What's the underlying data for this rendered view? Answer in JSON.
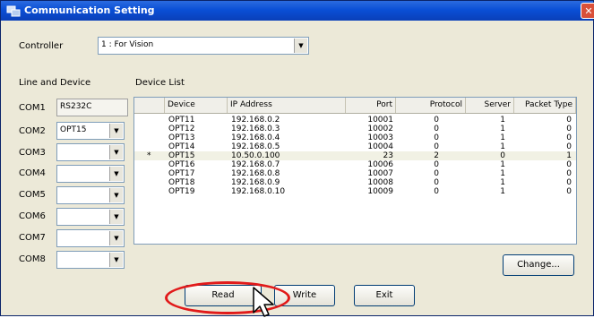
{
  "window": {
    "title": "Communication Setting",
    "close_glyph": "✕"
  },
  "controller": {
    "label": "Controller",
    "value": "1 : For Vision"
  },
  "line_device": {
    "label": "Line and Device",
    "com1": {
      "label": "COM1",
      "value": "RS232C"
    },
    "ports": [
      {
        "label": "COM2",
        "value": "OPT15"
      },
      {
        "label": "COM3",
        "value": ""
      },
      {
        "label": "COM4",
        "value": ""
      },
      {
        "label": "COM5",
        "value": ""
      },
      {
        "label": "COM6",
        "value": ""
      },
      {
        "label": "COM7",
        "value": ""
      },
      {
        "label": "COM8",
        "value": ""
      }
    ]
  },
  "device_list": {
    "label": "Device List",
    "columns": [
      "",
      "Device",
      "IP Address",
      "Port",
      "Protocol",
      "Server",
      "Packet Type"
    ],
    "rows": [
      {
        "marker": "",
        "device": "OPT11",
        "ip": "192.168.0.2",
        "port": "10001",
        "protocol": "0",
        "server": "1",
        "packet": "0"
      },
      {
        "marker": "",
        "device": "OPT12",
        "ip": "192.168.0.3",
        "port": "10002",
        "protocol": "0",
        "server": "1",
        "packet": "0"
      },
      {
        "marker": "",
        "device": "OPT13",
        "ip": "192.168.0.4",
        "port": "10003",
        "protocol": "0",
        "server": "1",
        "packet": "0"
      },
      {
        "marker": "",
        "device": "OPT14",
        "ip": "192.168.0.5",
        "port": "10004",
        "protocol": "0",
        "server": "1",
        "packet": "0"
      },
      {
        "marker": "*",
        "device": "OPT15",
        "ip": "10.50.0.100",
        "port": "23",
        "protocol": "2",
        "server": "0",
        "packet": "1"
      },
      {
        "marker": "",
        "device": "OPT16",
        "ip": "192.168.0.7",
        "port": "10006",
        "protocol": "0",
        "server": "1",
        "packet": "0"
      },
      {
        "marker": "",
        "device": "OPT17",
        "ip": "192.168.0.8",
        "port": "10007",
        "protocol": "0",
        "server": "1",
        "packet": "0"
      },
      {
        "marker": "",
        "device": "OPT18",
        "ip": "192.168.0.9",
        "port": "10008",
        "protocol": "0",
        "server": "1",
        "packet": "0"
      },
      {
        "marker": "",
        "device": "OPT19",
        "ip": "192.168.0.10",
        "port": "10009",
        "protocol": "0",
        "server": "1",
        "packet": "0"
      }
    ]
  },
  "buttons": {
    "change": "Change...",
    "read": "Read",
    "write": "Write",
    "exit": "Exit"
  },
  "icons": {
    "title": "network-icon",
    "dropdown": "chevron-down-icon",
    "cursor": "mouse-pointer-icon"
  },
  "colors": {
    "highlight": "#e11a1a",
    "title_bar": "#0a4fd6"
  }
}
